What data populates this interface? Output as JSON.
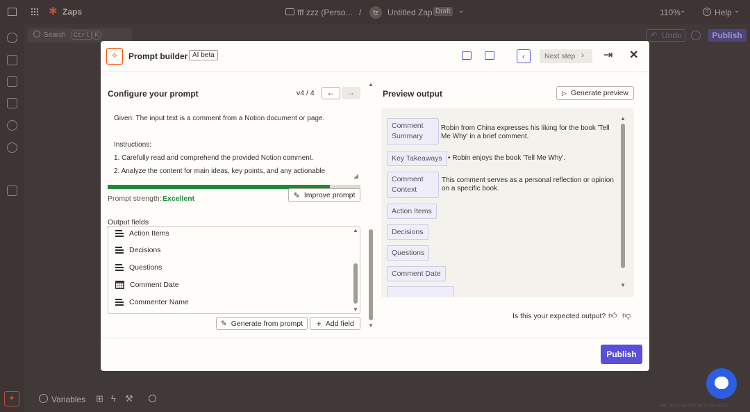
{
  "topbar": {
    "app_name": "Zaps",
    "folder": "fff zzz (Perso...",
    "separator": "/",
    "avatar_initials": "fz",
    "zap_title": "Untitled Zap",
    "status_badge": "Draft",
    "zoom": "110%",
    "help": "Help"
  },
  "subbar": {
    "search": "Search",
    "shortcut": "Ctrl",
    "shortcut_key": "K",
    "undo": "Undo",
    "publish": "Publish"
  },
  "bottombar": {
    "variables": "Variables"
  },
  "watermark": "ver. 2025-06-04T19:17:49.322Z",
  "modal": {
    "title": "Prompt builder",
    "badge": "AI beta",
    "next_step": "Next step",
    "configure": {
      "heading": "Configure your prompt",
      "version": "v4 / 4",
      "prompt_lines": [
        "Given: The input text is a comment from a Notion document or page.",
        "",
        "Instructions:",
        "1. Carefully read and comprehend the provided Notion comment.",
        "2. Analyze the content for main ideas, key points, and any actionable"
      ],
      "strength_label": "Prompt strength:",
      "strength_value": "Excellent",
      "strength_fraction": 0.88,
      "improve_button": "Improve prompt",
      "output_fields_label": "Output fields",
      "fields": [
        {
          "name": "Action Items",
          "icon": "text-lines-icon"
        },
        {
          "name": "Decisions",
          "icon": "text-lines-icon"
        },
        {
          "name": "Questions",
          "icon": "text-lines-icon"
        },
        {
          "name": "Comment Date",
          "icon": "calendar-icon"
        },
        {
          "name": "Commenter Name",
          "icon": "text-lines-icon"
        }
      ],
      "generate_button": "Generate from prompt",
      "add_field_button": "Add field"
    },
    "preview": {
      "heading": "Preview output",
      "generate_preview_button": "Generate preview",
      "rows": [
        {
          "key": "Comment Summary",
          "value": "Robin from China expresses his liking for the book 'Tell Me Why' in a brief comment."
        },
        {
          "key": "Key Takeaways",
          "value": "• Robin enjoys the book 'Tell Me Why'."
        },
        {
          "key": "Comment Context",
          "value": "This comment serves as a personal reflection or opinion on a specific book."
        },
        {
          "key": "Action Items",
          "value": ""
        },
        {
          "key": "Decisions",
          "value": ""
        },
        {
          "key": "Questions",
          "value": ""
        },
        {
          "key": "Comment Date",
          "value": ""
        }
      ],
      "feedback_question": "Is this your expected output?"
    },
    "publish_button": "Publish"
  }
}
